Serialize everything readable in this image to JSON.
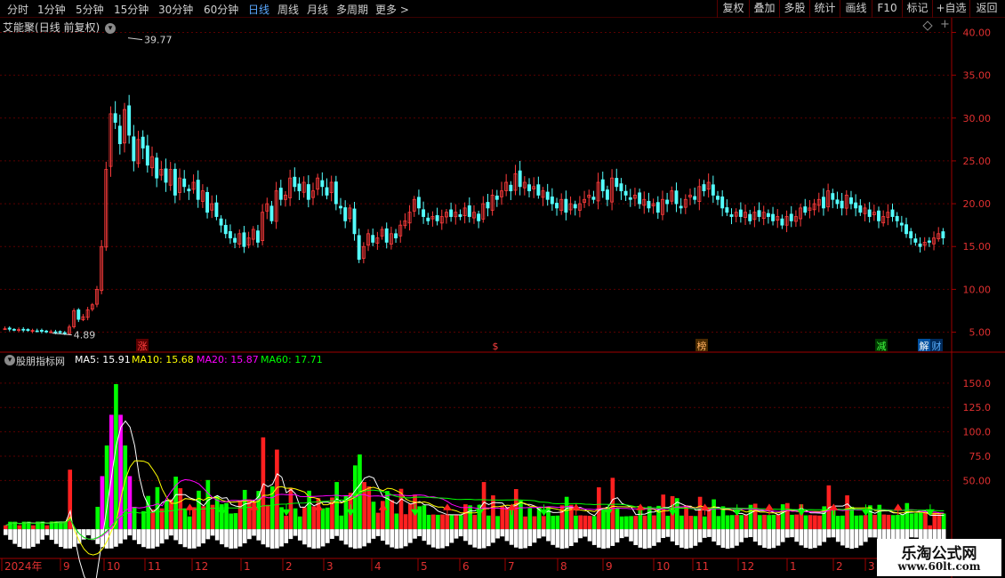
{
  "toolbar": {
    "periods": [
      "分时",
      "1分钟",
      "5分钟",
      "15分钟",
      "30分钟",
      "60分钟",
      "日线",
      "周线",
      "月线",
      "多周期",
      "更多 >"
    ],
    "active_period": "日线",
    "buttons": [
      "复权",
      "叠加",
      "多股",
      "统计",
      "画线",
      "F10",
      "标记",
      "+自选",
      "返回"
    ]
  },
  "stock": {
    "name": "艾能聚",
    "mode": "(日线 前复权)"
  },
  "price_panel": {
    "y_ticks": [
      "40.00",
      "35.00",
      "30.00",
      "25.00",
      "20.00",
      "15.00",
      "10.00",
      "5.00"
    ],
    "high_label": "39.77",
    "low_label": "4.89",
    "markers": [
      {
        "label": "涨",
        "color": "#ff4040",
        "bg": "#5a0000"
      },
      {
        "label": "$",
        "color": "#ff4040",
        "bg": ""
      },
      {
        "label": "榜",
        "color": "#ffb060",
        "bg": "#4a2a00"
      },
      {
        "label": "减",
        "color": "#40ff40",
        "bg": "#003a00"
      },
      {
        "label": "解",
        "color": "#ffffff",
        "bg": "#0050a0"
      },
      {
        "label": "财",
        "color": "#5ab0ff",
        "bg": "#002a5a"
      }
    ]
  },
  "indicator": {
    "name": "股朋指标网",
    "ma5_label": "MA5: 15.91",
    "ma10_label": "MA10: 15.68",
    "ma20_label": "MA20: 15.87",
    "ma60_label": "MA60: 17.71",
    "y_ticks": [
      "150.0",
      "125.0",
      "100.0",
      "75.0",
      "50.00"
    ]
  },
  "time_axis": [
    "2024年",
    "9",
    "10",
    "11",
    "12",
    "1",
    "2",
    "3",
    "4",
    "5",
    "6",
    "7",
    "8",
    "9",
    "10",
    "11",
    "12",
    "1",
    "2",
    "3"
  ],
  "colors": {
    "up": "#ff3c3c",
    "down": "#54ffff",
    "grid": "#5a0000",
    "axis": "#a00000",
    "ma5": "#ffffff",
    "ma10": "#ffff00",
    "ma20": "#ff00ff",
    "ma60": "#00ff00"
  },
  "watermark": {
    "line1": "乐淘公式网",
    "line2": "www.60lt.com"
  },
  "chart_data": {
    "type": "candlestick",
    "ylim": [
      3.5,
      41.5
    ],
    "high": 39.77,
    "low": 4.89,
    "closes": [
      5.4,
      5.35,
      5.3,
      5.3,
      5.25,
      5.2,
      5.2,
      5.15,
      5.1,
      5.1,
      5.05,
      5.0,
      4.95,
      4.9,
      5.6,
      7.5,
      6.5,
      6.8,
      7.6,
      8.2,
      10.0,
      15.0,
      24.0,
      30.5,
      29.5,
      27.0,
      31.0,
      28.0,
      25.0,
      27.5,
      26.5,
      24.5,
      25.5,
      23.0,
      24.0,
      22.5,
      24.0,
      21.0,
      23.0,
      22.0,
      21.5,
      22.5,
      20.5,
      21.5,
      19.0,
      20.0,
      18.5,
      17.5,
      16.5,
      16.0,
      15.5,
      16.5,
      15.0,
      16.0,
      17.0,
      15.5,
      19.0,
      20.0,
      18.0,
      21.5,
      20.5,
      21.0,
      23.0,
      22.0,
      21.5,
      22.5,
      20.5,
      21.5,
      23.0,
      22.0,
      21.0,
      22.5,
      20.0,
      19.5,
      18.0,
      19.5,
      16.5,
      13.5,
      15.0,
      16.5,
      15.5,
      16.0,
      17.0,
      15.5,
      16.5,
      16.0,
      17.5,
      18.0,
      19.0,
      20.5,
      19.5,
      18.5,
      18.0,
      18.5,
      18.0,
      18.5,
      19.0,
      18.5,
      19.0,
      18.5,
      19.5,
      18.5,
      19.0,
      18.0,
      20.0,
      19.5,
      21.0,
      20.5,
      21.5,
      22.5,
      21.5,
      23.5,
      22.0,
      22.5,
      21.5,
      22.0,
      21.0,
      21.5,
      20.5,
      20.0,
      19.5,
      20.5,
      19.0,
      20.0,
      19.5,
      20.0,
      20.5,
      21.0,
      20.5,
      22.5,
      21.5,
      20.5,
      23.0,
      22.0,
      21.5,
      21.0,
      20.5,
      21.0,
      20.0,
      20.5,
      19.5,
      20.0,
      19.0,
      20.5,
      20.0,
      21.5,
      20.0,
      19.5,
      20.5,
      21.0,
      20.5,
      22.0,
      21.5,
      22.5,
      21.0,
      20.5,
      19.5,
      19.0,
      18.5,
      19.0,
      18.5,
      19.0,
      18.0,
      19.0,
      18.5,
      19.0,
      18.5,
      18.0,
      18.5,
      17.5,
      18.5,
      18.0,
      18.5,
      19.5,
      19.0,
      19.5,
      20.0,
      20.5,
      19.5,
      21.5,
      20.5,
      20.0,
      19.5,
      21.0,
      20.0,
      19.5,
      19.0,
      19.5,
      18.5,
      19.0,
      18.0,
      18.5,
      19.0,
      18.5,
      18.0,
      17.5,
      16.5,
      16.0,
      15.5,
      15.0,
      15.5,
      15.5,
      16.0,
      16.5,
      16.0
    ]
  }
}
